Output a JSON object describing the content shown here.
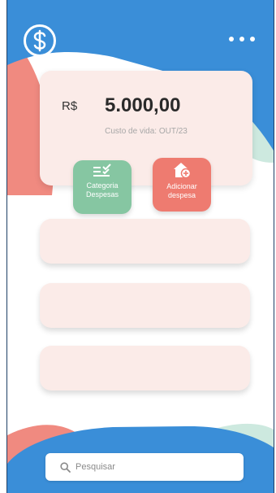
{
  "header": {
    "logo_icon": "dollar-circle-icon",
    "menu_icon": "more-horizontal-icon"
  },
  "balance": {
    "currency": "R$",
    "amount": "5.000,00",
    "subtitle": "Custo de vida: OUT/23"
  },
  "actions": {
    "category": {
      "label": "Categoria Despesas",
      "icon": "list-check-icon",
      "color": "#86c6a2"
    },
    "add_expense": {
      "label": "Adicionar despesa",
      "icon": "house-plus-icon",
      "color": "#ee7b70"
    }
  },
  "list": {
    "items": [
      "",
      "",
      ""
    ]
  },
  "search": {
    "placeholder": "Pesquisar",
    "icon": "search-icon"
  },
  "colors": {
    "primary_blue": "#3a8ed8",
    "accent_red": "#f08a80",
    "accent_mint": "#c9e9dd",
    "card_bg": "#fbebe8"
  }
}
